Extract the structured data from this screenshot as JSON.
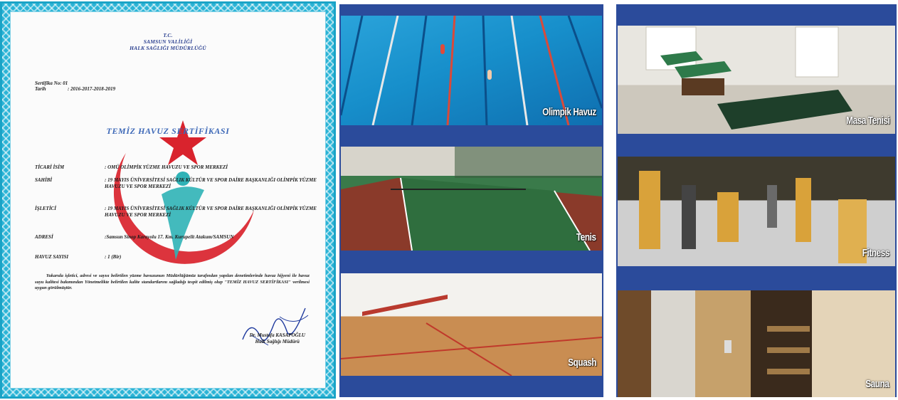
{
  "certificate": {
    "header": [
      "T.C.",
      "SAMSUN VALİLİĞİ",
      "HALK SAĞLIĞI MÜDÜRLÜĞÜ"
    ],
    "cert_no_label": "Sertifika No: 01",
    "date_label": "Tarih",
    "date_value": ": 2016-2017-2018-2019",
    "title": "TEMİZ HAVUZ SERTİFİKASI",
    "fields": [
      {
        "label": "TİCARİ İSİM",
        "value": ": OMÜ OLİMPİK YÜZME HAVUZU VE SPOR MERKEZİ"
      },
      {
        "label": "SAHİBİ",
        "value": ": 19 MAYIS ÜNİVERSİTESİ SAĞLIK KÜLTÜR VE SPOR DAİRE BAŞKANLIĞI OLİMPİK YÜZME HAVUZU VE SPOR MERKEZİ"
      },
      {
        "label": "İŞLETİCİ",
        "value": ": 19 MAYIS ÜNİVERSİTESİ SAĞLIK KÜLTÜR VE SPOR DAİRE BAŞKANLIĞI OLİMPİK YÜZME HAVUZU VE SPOR MERKEZİ"
      },
      {
        "label": "ADRESİ",
        "value": ":Samsun Sinop Karayolu 17. Km. Kurupelit Atakum/SAMSUN"
      },
      {
        "label": "HAVUZ SAYISI",
        "value": ": 1 (Bir)"
      }
    ],
    "body": "Yukarıda işletici, adresi ve sayısı belirtilen yüzme havuzunun Müdürlüğümüz tarafından yapılan denetimlerinde havuz hijyeni ile havuz suyu kalitesi bakımından Yönetmelikte belirtilen kalite standartlarını sağladığı tespit edilmiş olup \"TEMİZ HAVUZ SERTİFİKASI\" verilmesi uygun görülmüştür.",
    "signer_name": "Dr. Mustafa KASAPOĞLU",
    "signer_title": "Halk Sağlığı Müdürü",
    "colors": {
      "border": "#1aa3c6",
      "crescent": "#d9232d",
      "title": "#3d68b7",
      "figure": "#2fb2b6"
    }
  },
  "panels": {
    "olimpik": "Olimpik Havuz",
    "tenis": "Tenis",
    "squash": "Squash",
    "masa": "Masa Tenisi",
    "fitness": "Fitness",
    "sauna": "Sauna"
  },
  "colors": {
    "panel_bar": "#2b4b9b"
  }
}
